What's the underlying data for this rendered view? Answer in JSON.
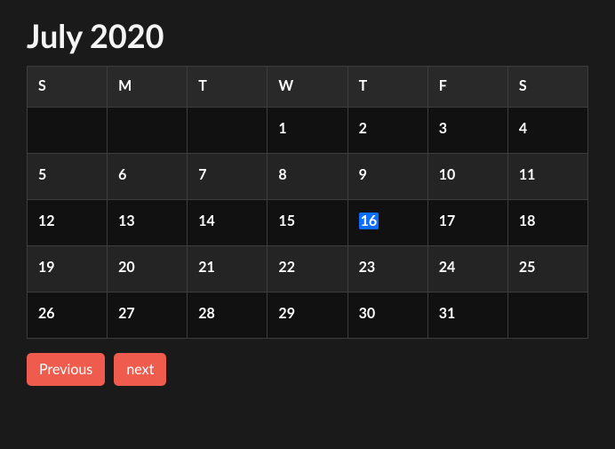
{
  "title": "July 2020",
  "day_headers": [
    "S",
    "M",
    "T",
    "W",
    "T",
    "F",
    "S"
  ],
  "weeks": [
    [
      "",
      "",
      "",
      "1",
      "2",
      "3",
      "4"
    ],
    [
      "5",
      "6",
      "7",
      "8",
      "9",
      "10",
      "11"
    ],
    [
      "12",
      "13",
      "14",
      "15",
      "16",
      "17",
      "18"
    ],
    [
      "19",
      "20",
      "21",
      "22",
      "23",
      "24",
      "25"
    ],
    [
      "26",
      "27",
      "28",
      "29",
      "30",
      "31",
      ""
    ]
  ],
  "today": "16",
  "buttons": {
    "prev": "Previous",
    "next": "next"
  }
}
